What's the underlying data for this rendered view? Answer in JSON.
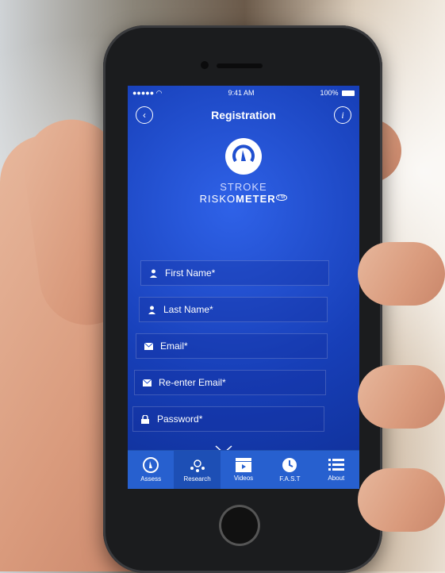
{
  "status": {
    "time": "9:41 AM",
    "battery": "100%"
  },
  "nav": {
    "title": "Registration",
    "back_icon": "back-chevron-icon",
    "info_icon": "info-icon"
  },
  "brand": {
    "line1": "STROKE",
    "line2a": "RISKO",
    "line2b": "METER",
    "tm": "TM"
  },
  "form": {
    "first_name": "First Name*",
    "last_name": "Last Name*",
    "email": "Email*",
    "re_email": "Re-enter Email*",
    "password": "Password*"
  },
  "tabs": [
    {
      "label": "Assess",
      "icon": "gauge-icon"
    },
    {
      "label": "Research",
      "icon": "research-icon"
    },
    {
      "label": "Videos",
      "icon": "clapper-icon"
    },
    {
      "label": "F.A.S.T",
      "icon": "clock-icon"
    },
    {
      "label": "About",
      "icon": "list-icon"
    }
  ],
  "colors": {
    "screen": "#1f4fd0",
    "tabbar": "#2760cf"
  }
}
